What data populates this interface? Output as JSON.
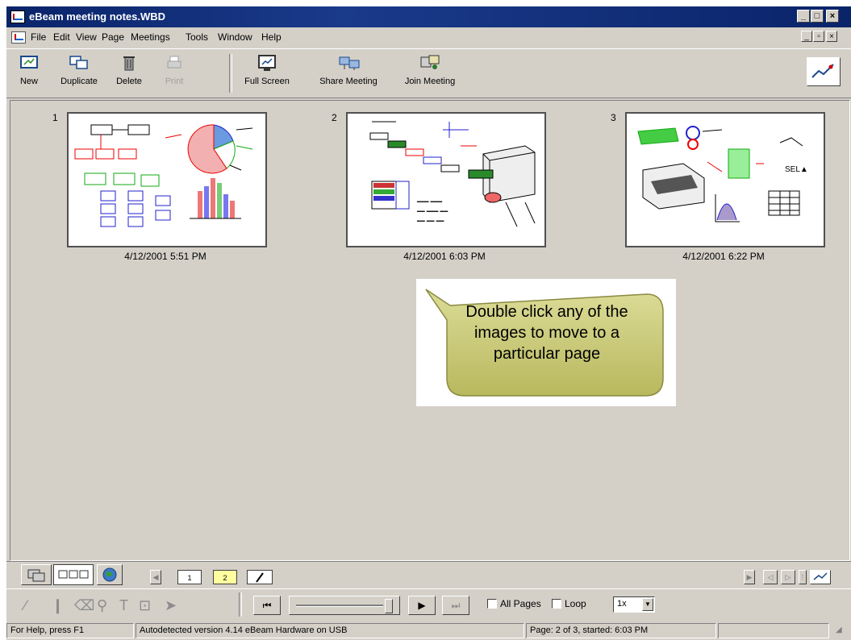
{
  "window": {
    "title": "eBeam meeting notes.WBD"
  },
  "menu": [
    "File",
    "Edit",
    "View",
    "Page",
    "Meetings",
    "Tools",
    "Window",
    "Help"
  ],
  "toolbar": {
    "new": "New",
    "duplicate": "Duplicate",
    "delete": "Delete",
    "print": "Print",
    "full_screen": "Full Screen",
    "share_meeting": "Share Meeting",
    "join_meeting": "Join Meeting"
  },
  "pages": [
    {
      "number": "1",
      "date": "4/12/2001  5:51 PM"
    },
    {
      "number": "2",
      "date": "4/12/2001  6:03 PM"
    },
    {
      "number": "3",
      "date": "4/12/2001  6:22 PM"
    }
  ],
  "callout": {
    "text": "Double click any of the images to move to a particular page"
  },
  "page_tabs": [
    "1",
    "2"
  ],
  "playback": {
    "all_pages_label": "All Pages",
    "loop_label": "Loop",
    "speed": "1x"
  },
  "status": {
    "help": "For Help, press F1",
    "detected": "Autodetected version 4.14 eBeam Hardware on USB",
    "page_info": "Page: 2 of 3, started: 6:03 PM"
  },
  "colors": {
    "titlebar": "#0a246a",
    "window_bg": "#d4d0c8",
    "callout": "#c8c878",
    "page_tab_active": "#ffffa0"
  }
}
